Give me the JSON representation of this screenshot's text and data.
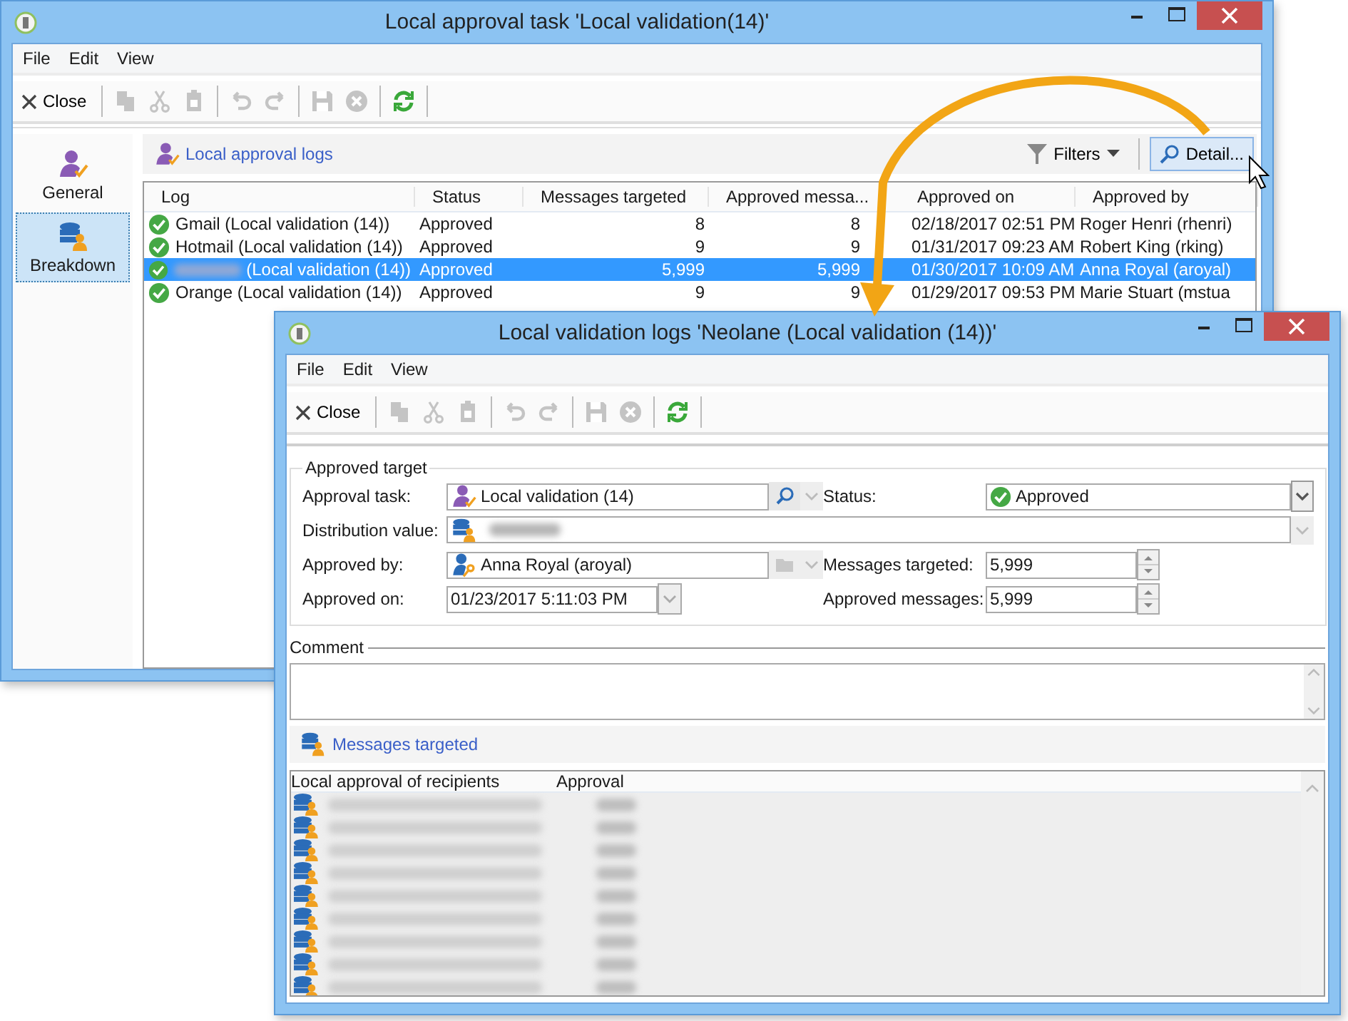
{
  "main_window": {
    "title": "Local approval task 'Local validation(14)'",
    "menu": [
      "File",
      "Edit",
      "View"
    ],
    "toolbar": {
      "close": "Close",
      "tools": [
        {
          "kind": "copy",
          "disabled": true
        },
        {
          "kind": "cut",
          "disabled": true
        },
        {
          "kind": "paste",
          "disabled": true
        },
        {
          "kind": "undo",
          "disabled": true
        },
        {
          "kind": "redo",
          "disabled": true
        },
        {
          "kind": "save",
          "disabled": true
        },
        {
          "kind": "cancel",
          "disabled": true
        },
        {
          "kind": "refresh",
          "disabled": false
        }
      ]
    },
    "sidebar": {
      "items": [
        {
          "label": "General",
          "kind": "general",
          "selected": false
        },
        {
          "label": "Breakdown",
          "kind": "breakdown",
          "selected": true
        }
      ]
    },
    "panel": {
      "title": "Local approval logs",
      "filters": "Filters",
      "detail_button": "Detail..."
    },
    "table": {
      "columns": [
        "Log",
        "Status",
        "Messages targeted",
        "Approved messa...",
        "Approved on",
        "Approved by"
      ],
      "rows": [
        {
          "log": "Gmail (Local validation (14))",
          "name_hidden": false,
          "status": "Approved",
          "messages_targeted": "8",
          "approved_messages": "8",
          "approved_on": "02/18/2017 02:51 PM",
          "approved_by": "Roger Henri (rhenri)",
          "selected": false
        },
        {
          "log": "Hotmail (Local validation (14))",
          "name_hidden": false,
          "status": "Approved",
          "messages_targeted": "9",
          "approved_messages": "9",
          "approved_on": "01/31/2017 09:23 AM",
          "approved_by": "Robert King (rking)",
          "selected": false
        },
        {
          "log": "(Local validation (14))",
          "name_hidden": true,
          "status": "Approved",
          "messages_targeted": "5,999",
          "approved_messages": "5,999",
          "approved_on": "01/30/2017 10:09 AM",
          "approved_by": "Anna Royal (aroyal)",
          "selected": true
        },
        {
          "log": "Orange (Local validation (14))",
          "name_hidden": false,
          "status": "Approved",
          "messages_targeted": "9",
          "approved_messages": "9",
          "approved_on": "01/29/2017 09:53 PM",
          "approved_by": "Marie Stuart (mstua",
          "selected": false
        }
      ]
    }
  },
  "detail_window": {
    "title": "Local validation logs 'Neolane (Local validation (14))'",
    "menu": [
      "File",
      "Edit",
      "View"
    ],
    "toolbar": {
      "close": "Close",
      "tools": [
        {
          "kind": "copy",
          "disabled": true
        },
        {
          "kind": "cut",
          "disabled": true
        },
        {
          "kind": "paste",
          "disabled": true
        },
        {
          "kind": "undo",
          "disabled": true
        },
        {
          "kind": "redo",
          "disabled": true
        },
        {
          "kind": "save",
          "disabled": true
        },
        {
          "kind": "cancel",
          "disabled": true
        },
        {
          "kind": "refresh",
          "disabled": false
        }
      ]
    },
    "form": {
      "group_title": "Approved target",
      "approval_task": {
        "label": "Approval task:",
        "value": "Local validation (14)"
      },
      "status": {
        "label": "Status:",
        "value": "Approved"
      },
      "distribution_value": {
        "label": "Distribution value:"
      },
      "approved_by": {
        "label": "Approved by:",
        "value": "Anna Royal (aroyal)"
      },
      "messages_targeted": {
        "label": "Messages targeted:",
        "value": "5,999"
      },
      "approved_on": {
        "label": "Approved on:",
        "value": "01/23/2017 5:11:03 PM"
      },
      "approved_messages": {
        "label": "Approved messages:",
        "value": "5,999"
      }
    },
    "comment": {
      "label": "Comment"
    },
    "link": "Messages targeted",
    "list": {
      "columns": [
        "Local approval of recipients",
        "Approval"
      ]
    }
  }
}
